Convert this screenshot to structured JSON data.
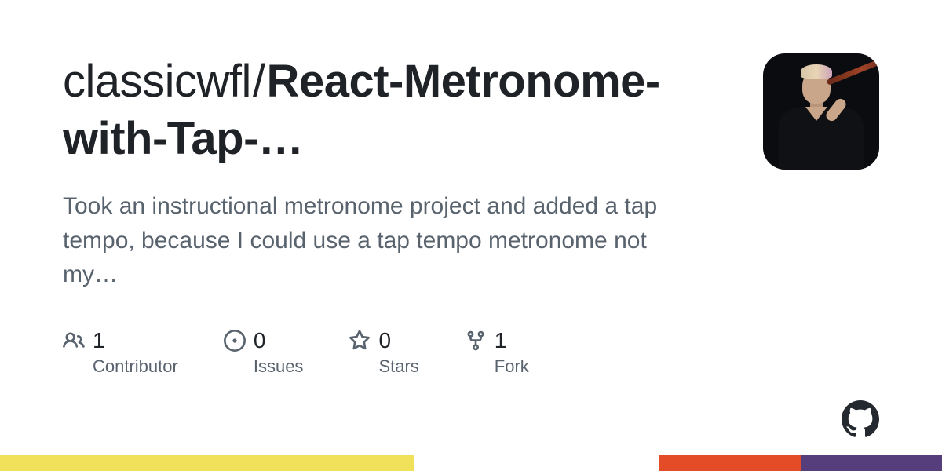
{
  "repo": {
    "owner": "classicwfl",
    "name_display": "React-Metronome-with-Tap-…",
    "description": "Took an instructional metronome project and added a tap tempo, because I could use a tap tempo metronome not my…"
  },
  "stats": {
    "contributors": {
      "count": "1",
      "label": "Contributor"
    },
    "issues": {
      "count": "0",
      "label": "Issues"
    },
    "stars": {
      "count": "0",
      "label": "Stars"
    },
    "forks": {
      "count": "1",
      "label": "Fork"
    }
  },
  "colors": {
    "bar": [
      {
        "hex": "#f1e05a",
        "pct": 44
      },
      {
        "hex": "#ffffff",
        "pct": 26
      },
      {
        "hex": "#e34c26",
        "pct": 15
      },
      {
        "hex": "#563d7c",
        "pct": 15
      }
    ]
  }
}
